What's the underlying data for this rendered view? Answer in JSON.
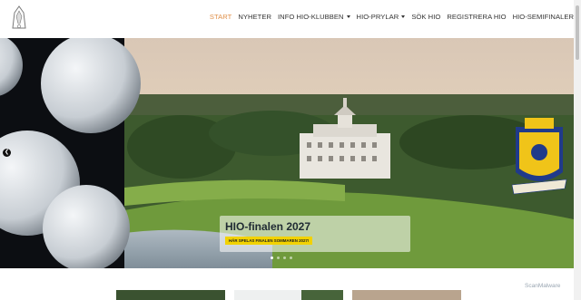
{
  "nav": {
    "items": [
      {
        "label": "START",
        "active": true,
        "dropdown": false
      },
      {
        "label": "NYHETER",
        "active": false,
        "dropdown": false
      },
      {
        "label": "INFO HIO-KLUBBEN",
        "active": false,
        "dropdown": true
      },
      {
        "label": "HIO-PRYLAR",
        "active": false,
        "dropdown": true
      },
      {
        "label": "SÖK HIO",
        "active": false,
        "dropdown": false
      },
      {
        "label": "REGISTRERA HIO",
        "active": false,
        "dropdown": false
      },
      {
        "label": "HIO-SEMIFINALER",
        "active": false,
        "dropdown": false
      }
    ]
  },
  "hero": {
    "title": "HIO-finalen 2027",
    "button_label": "HÄR SPELAS FINALEN SOMMAREN 2027!",
    "crest_motto": "TENEBIS PINE AD FITAM",
    "slide_count": 4,
    "active_slide": 1
  },
  "watermark": "ScanMalware",
  "colors": {
    "accent": "#e0904a",
    "button": "#f2d200"
  }
}
